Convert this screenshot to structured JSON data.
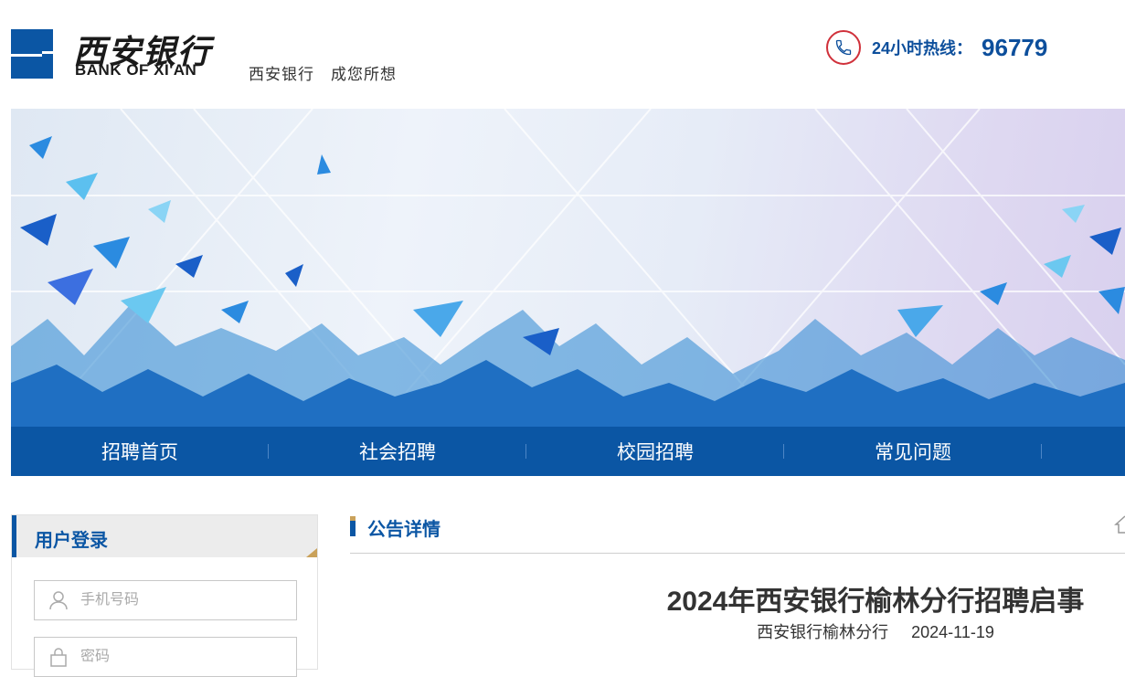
{
  "brand": {
    "name_cn": "西安银行",
    "name_en": "BANK OF XI'AN",
    "slogan": "西安银行　成您所想",
    "color": "#0b56a4"
  },
  "hotline": {
    "label": "24小时热线：",
    "number": "96779",
    "icon": "phone-icon"
  },
  "nav": {
    "items": [
      {
        "label": "招聘首页"
      },
      {
        "label": "社会招聘"
      },
      {
        "label": "校园招聘"
      },
      {
        "label": "常见问题"
      }
    ]
  },
  "login": {
    "title": "用户登录",
    "phone_placeholder": "手机号码",
    "password_placeholder": "密码"
  },
  "notice": {
    "section_title": "公告详情",
    "title": "2024年西安银行榆林分行招聘启事",
    "publisher": "西安银行榆林分行",
    "date": "2024-11-19"
  }
}
